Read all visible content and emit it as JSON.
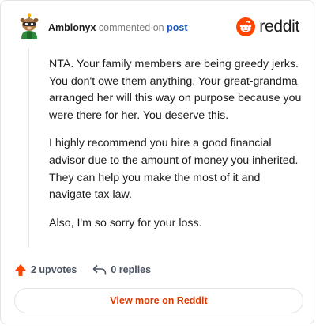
{
  "comment": {
    "author": "Amblonyx",
    "action_text": "commented on",
    "target_link": "post",
    "paragraphs": [
      "NTA. Your family members are being greedy jerks. You don't owe them anything. Your great-grandma arranged her will this way on purpose because you were there for her. You deserve this.",
      "I highly recommend you hire a good financial advisor due to the amount of money you inherited. They can help you make the most of it and navigate tax law.",
      "Also, I'm so sorry for your loss."
    ]
  },
  "brand": {
    "wordmark": "reddit",
    "color": "#ff4500"
  },
  "actions": {
    "upvotes_label": "2 upvotes",
    "replies_label": "0 replies",
    "upvote_color": "#ff4500"
  },
  "cta": {
    "label": "View more on Reddit"
  }
}
